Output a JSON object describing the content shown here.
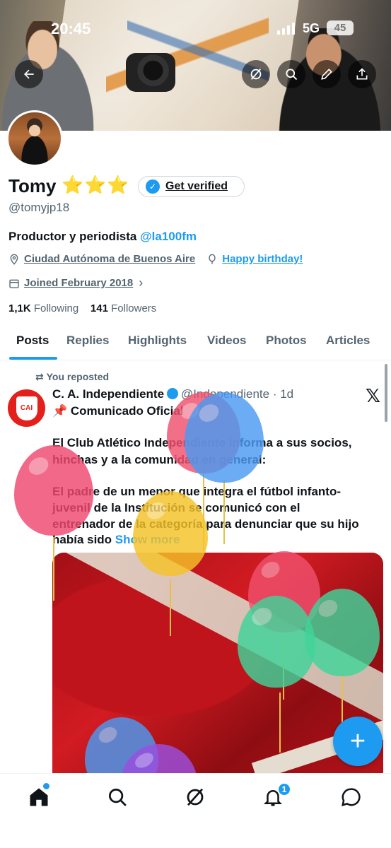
{
  "status_bar": {
    "time": "20:45",
    "network": "5G",
    "battery": "45"
  },
  "profile": {
    "name": "Tomy",
    "stars": "⭐⭐⭐",
    "verify_label": "Get verified",
    "handle": "@tomyjp18",
    "bio_text": "Productor y periodista ",
    "bio_mention": "@la100fm",
    "location": "Ciudad Autónoma de Buenos Aire",
    "birthday": "Happy birthday!",
    "joined": "Joined February 2018",
    "following_count": "1,1K",
    "following_label": "Following",
    "followers_count": "141",
    "followers_label": "Followers"
  },
  "tabs": [
    "Posts",
    "Replies",
    "Highlights",
    "Videos",
    "Photos",
    "Articles"
  ],
  "tweet": {
    "repost_label": "You reposted",
    "author": "C. A. Independiente",
    "author_handle": "@Independiente",
    "time": "· 1d",
    "logo_text": "CAI",
    "lines": [
      "📌 Comunicado Oficial",
      "El Club Atlético Independiente informa a sus socios,",
      "hinchas y a la comunidad en general:",
      "El padre de un menor que integra el fútbol infanto-",
      "juvenil de la Institución se comunicó con el",
      "entrenador de la categoría para denunciar que su hijo",
      "había sido "
    ],
    "show_more": "Show more"
  },
  "fab_label": "+",
  "nav": {
    "notifications_badge": "1"
  },
  "colors": {
    "accent": "#1d9bf0",
    "text": "#0f1419",
    "muted": "#536471"
  }
}
